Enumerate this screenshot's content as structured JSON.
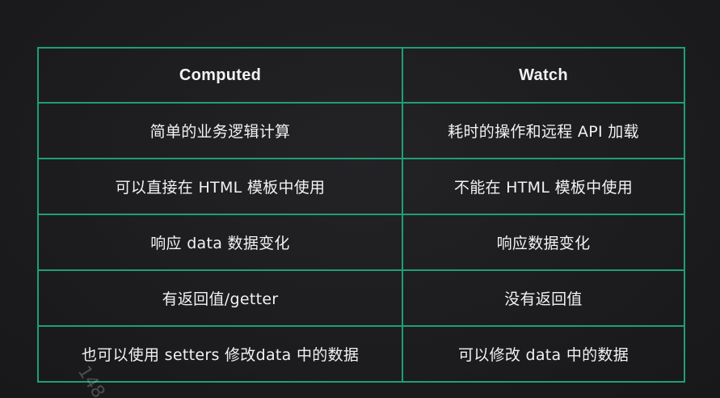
{
  "table": {
    "headers": [
      "Computed",
      "Watch"
    ],
    "rows": [
      [
        "简单的业务逻辑计算",
        "耗时的操作和远程 API 加载"
      ],
      [
        "可以直接在 HTML 模板中使用",
        "不能在 HTML 模板中使用"
      ],
      [
        "响应 data 数据变化",
        "响应数据变化"
      ],
      [
        "有返回值/getter",
        "没有返回值"
      ],
      [
        "也可以使用 setters 修改data 中的数据",
        "可以修改 data 中的数据"
      ]
    ]
  },
  "watermark": "148",
  "colors": {
    "background": "#1c1c1e",
    "border": "#1f9f72",
    "text": "#f2f2f2"
  }
}
